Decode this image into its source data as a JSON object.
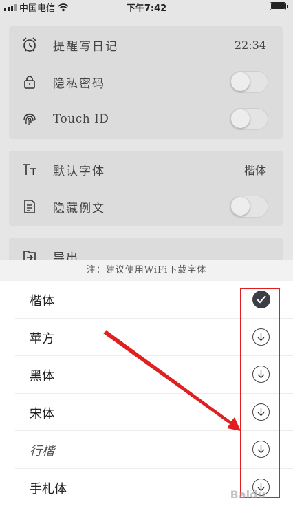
{
  "status_bar": {
    "carrier": "中国电信",
    "time": "下午7:42"
  },
  "settings": {
    "card1": [
      {
        "label": "提醒写日记",
        "value": "22:34",
        "icon": "alarm-clock-icon"
      },
      {
        "label": "隐私密码",
        "toggle": "off",
        "icon": "lock-icon"
      },
      {
        "label": "Touch ID",
        "toggle": "off",
        "icon": "fingerprint-icon"
      }
    ],
    "card2": [
      {
        "label": "默认字体",
        "value": "楷体",
        "icon": "font-icon"
      },
      {
        "label": "隐藏例文",
        "toggle": "off",
        "icon": "document-icon"
      }
    ],
    "card3": [
      {
        "label": "导出",
        "icon": "export-icon"
      }
    ]
  },
  "font_sheet": {
    "note": "注：建议使用WiFi下载字体",
    "fonts": [
      {
        "name": "楷体",
        "state": "selected"
      },
      {
        "name": "苹方",
        "state": "download"
      },
      {
        "name": "黑体",
        "state": "download"
      },
      {
        "name": "宋体",
        "state": "download"
      },
      {
        "name": "行楷",
        "state": "download"
      },
      {
        "name": "手札体",
        "state": "download"
      }
    ]
  },
  "colors": {
    "annotation": "#e02020",
    "check_fill": "#3d3d46"
  },
  "watermark": "Baidu"
}
